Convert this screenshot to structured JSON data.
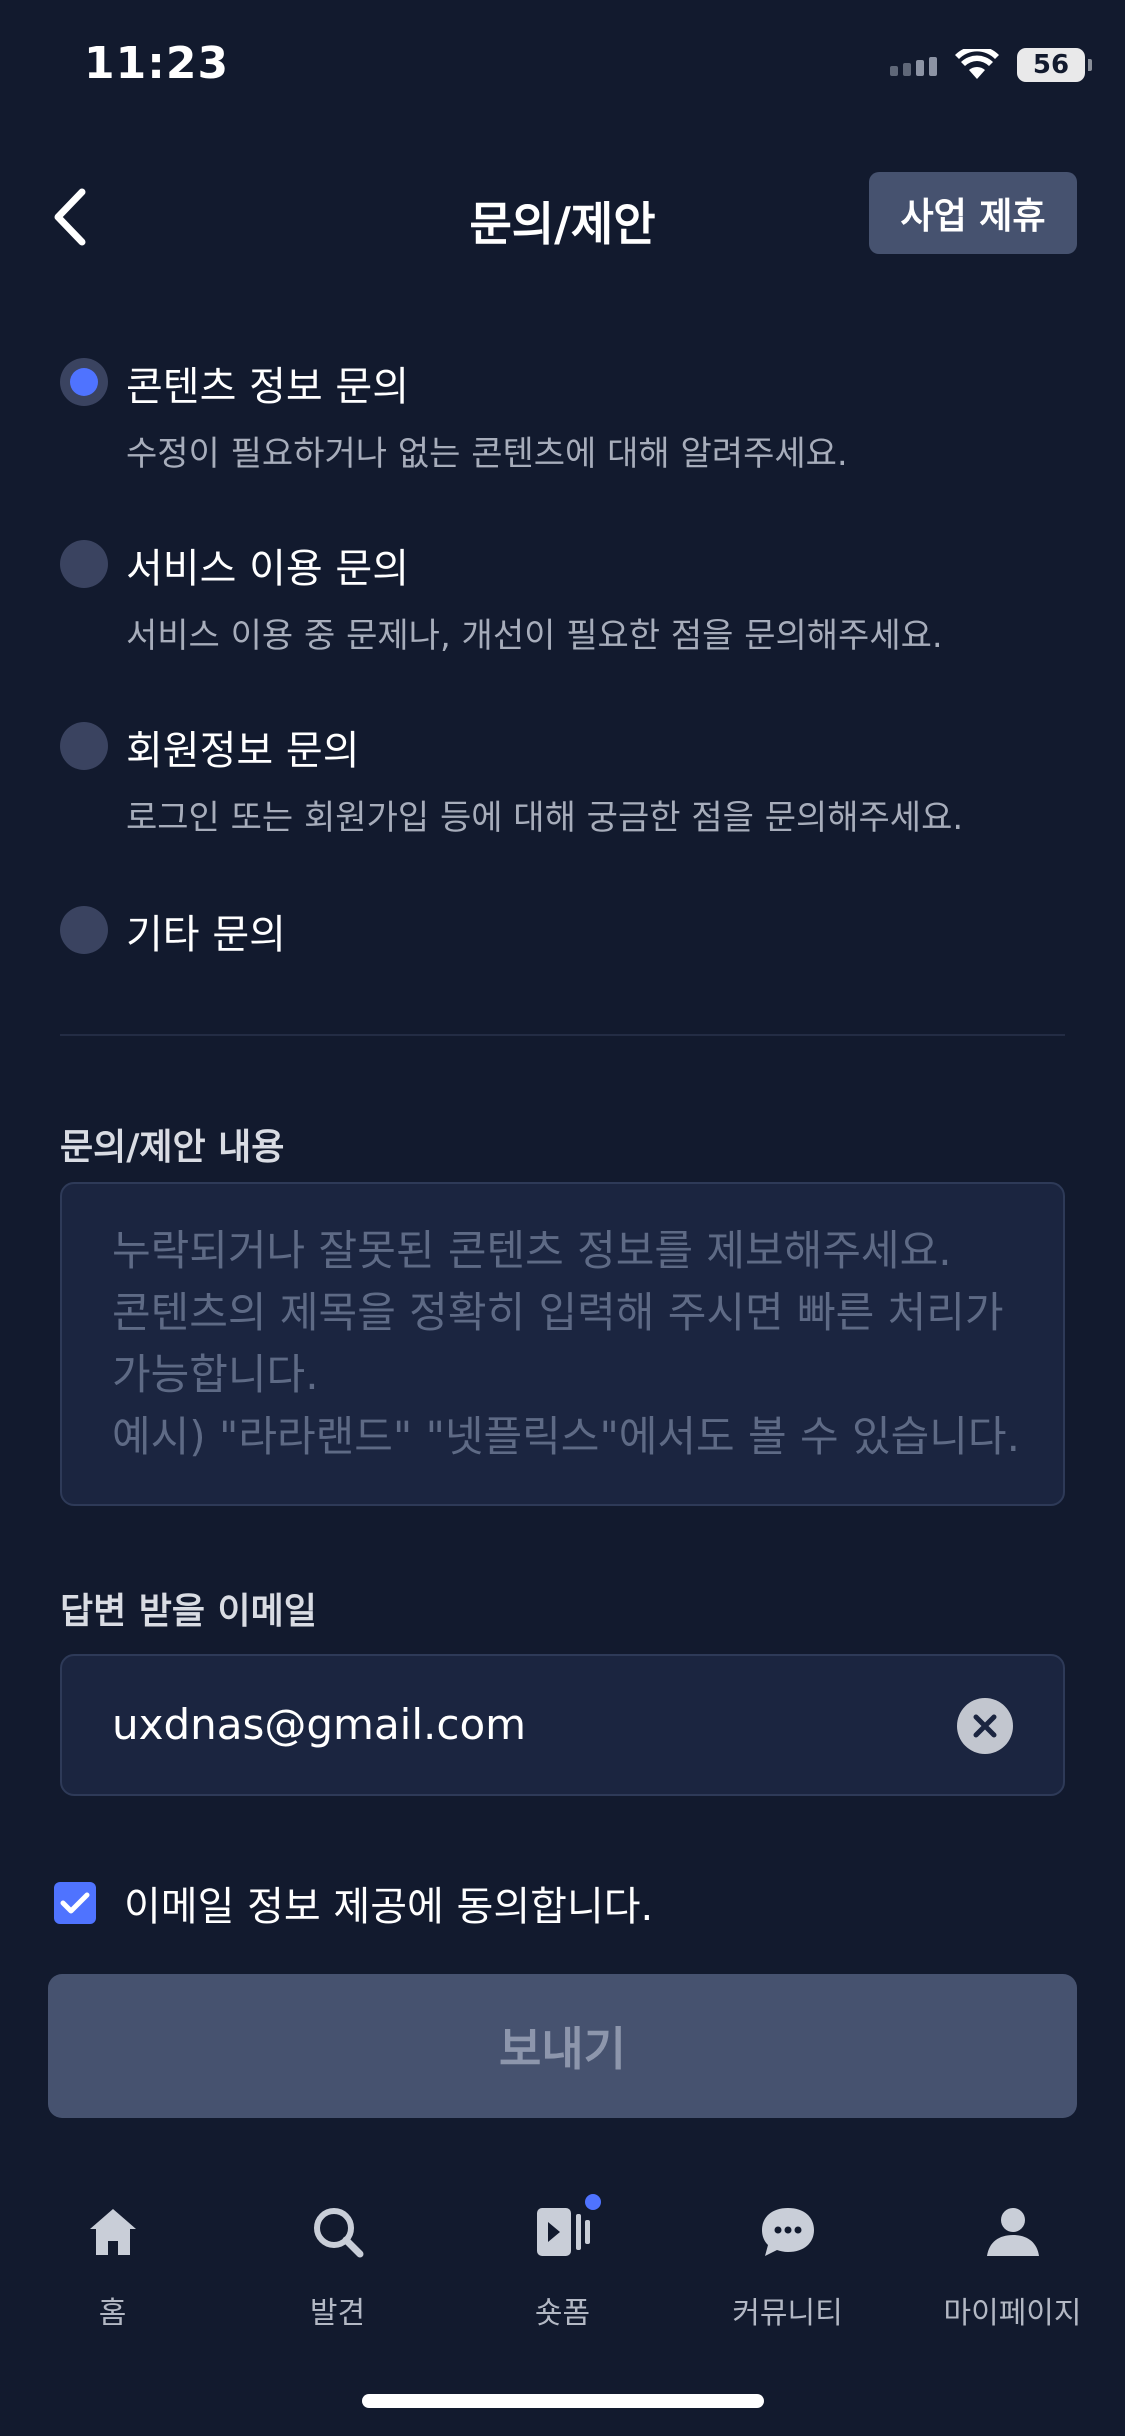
{
  "status_bar": {
    "time": "11:23",
    "battery": "56"
  },
  "header": {
    "title": "문의/제안",
    "partner_button": "사업 제휴"
  },
  "options": [
    {
      "title": "콘텐츠 정보 문의",
      "desc": "수정이 필요하거나 없는 콘텐츠에 대해 알려주세요.",
      "selected": true
    },
    {
      "title": "서비스 이용 문의",
      "desc": "서비스 이용 중 문제나, 개선이 필요한 점을 문의해주세요.",
      "selected": false
    },
    {
      "title": "회원정보 문의",
      "desc": "로그인 또는 회원가입 등에 대해 궁금한 점을 문의해주세요.",
      "selected": false
    },
    {
      "title": "기타 문의",
      "desc": "",
      "selected": false
    }
  ],
  "content_section": {
    "label": "문의/제안 내용",
    "placeholder": "누락되거나 잘못된 콘텐츠 정보를 제보해주세요.\n콘텐츠의 제목을 정확히 입력해 주시면 빠른 처리가 가능합니다.\n예시) \"라라랜드\" \"넷플릭스\"에서도 볼 수 있습니다."
  },
  "email_section": {
    "label": "답변 받을 이메일",
    "value": "uxdnas@gmail.com"
  },
  "consent": {
    "label": "이메일 정보 제공에 동의합니다.",
    "checked": true
  },
  "send_button": "보내기",
  "tab_bar": [
    {
      "label": "홈",
      "icon": "home-icon"
    },
    {
      "label": "발견",
      "icon": "search-icon"
    },
    {
      "label": "숏폼",
      "icon": "shortform-icon"
    },
    {
      "label": "커뮤니티",
      "icon": "chat-icon"
    },
    {
      "label": "마이페이지",
      "icon": "person-icon"
    }
  ],
  "colors": {
    "background": "#121a2e",
    "accent": "#4f73ff",
    "button": "#46526f"
  }
}
